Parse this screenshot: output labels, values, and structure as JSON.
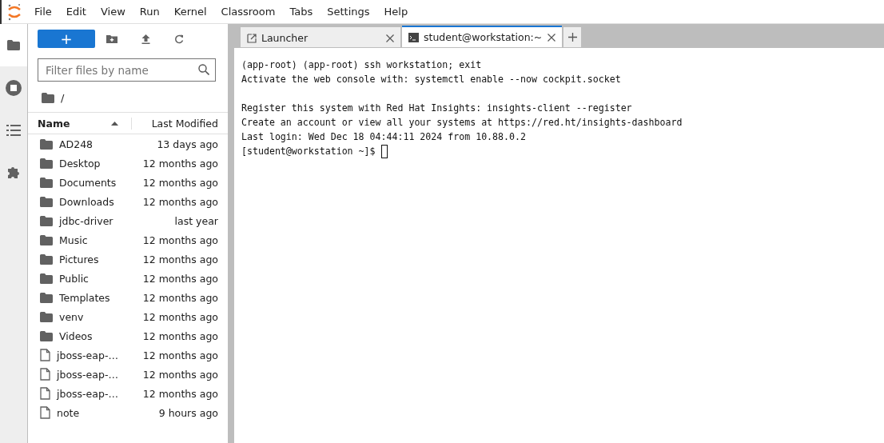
{
  "menu": [
    "File",
    "Edit",
    "View",
    "Run",
    "Kernel",
    "Classroom",
    "Tabs",
    "Settings",
    "Help"
  ],
  "sidebar_tabs": [
    {
      "kind": "folder",
      "selected": true
    },
    {
      "kind": "stop",
      "selected": false
    },
    {
      "kind": "list",
      "selected": false
    },
    {
      "kind": "puzzle",
      "selected": false
    }
  ],
  "file_browser": {
    "new_button": "+",
    "filter": {
      "placeholder": "Filter files by name"
    },
    "path": "/",
    "columns": [
      "Name",
      "Last Modified"
    ],
    "files": [
      {
        "kind": "folder",
        "name": "AD248",
        "modified": "13 days ago"
      },
      {
        "kind": "folder",
        "name": "Desktop",
        "modified": "12 months ago"
      },
      {
        "kind": "folder",
        "name": "Documents",
        "modified": "12 months ago"
      },
      {
        "kind": "folder",
        "name": "Downloads",
        "modified": "12 months ago"
      },
      {
        "kind": "folder",
        "name": "jdbc-driver",
        "modified": "last year"
      },
      {
        "kind": "folder",
        "name": "Music",
        "modified": "12 months ago"
      },
      {
        "kind": "folder",
        "name": "Pictures",
        "modified": "12 months ago"
      },
      {
        "kind": "folder",
        "name": "Public",
        "modified": "12 months ago"
      },
      {
        "kind": "folder",
        "name": "Templates",
        "modified": "12 months ago"
      },
      {
        "kind": "folder",
        "name": "venv",
        "modified": "12 months ago"
      },
      {
        "kind": "folder",
        "name": "Videos",
        "modified": "12 months ago"
      },
      {
        "kind": "file",
        "name": "jboss-eap-…",
        "modified": "12 months ago"
      },
      {
        "kind": "file",
        "name": "jboss-eap-…",
        "modified": "12 months ago"
      },
      {
        "kind": "file",
        "name": "jboss-eap-…",
        "modified": "12 months ago"
      },
      {
        "kind": "file",
        "name": "note",
        "modified": "9 hours ago"
      }
    ]
  },
  "tabs": [
    {
      "kind": "launcher",
      "label": "Launcher",
      "selected": false
    },
    {
      "kind": "terminal",
      "label": "student@workstation:~",
      "selected": true
    }
  ],
  "terminal": {
    "blocks": [
      [
        "(app-root) (app-root) ssh workstation; exit",
        "Activate the web console with: systemctl enable --now cockpit.socket"
      ],
      [
        "Register this system with Red Hat Insights: insights-client --register",
        "Create an account or view all your systems at https://red.ht/insights-dashboard",
        "Last login: Wed Dec 18 04:44:11 2024 from 10.88.0.2"
      ]
    ],
    "prompt": "[student@workstation ~]$"
  }
}
